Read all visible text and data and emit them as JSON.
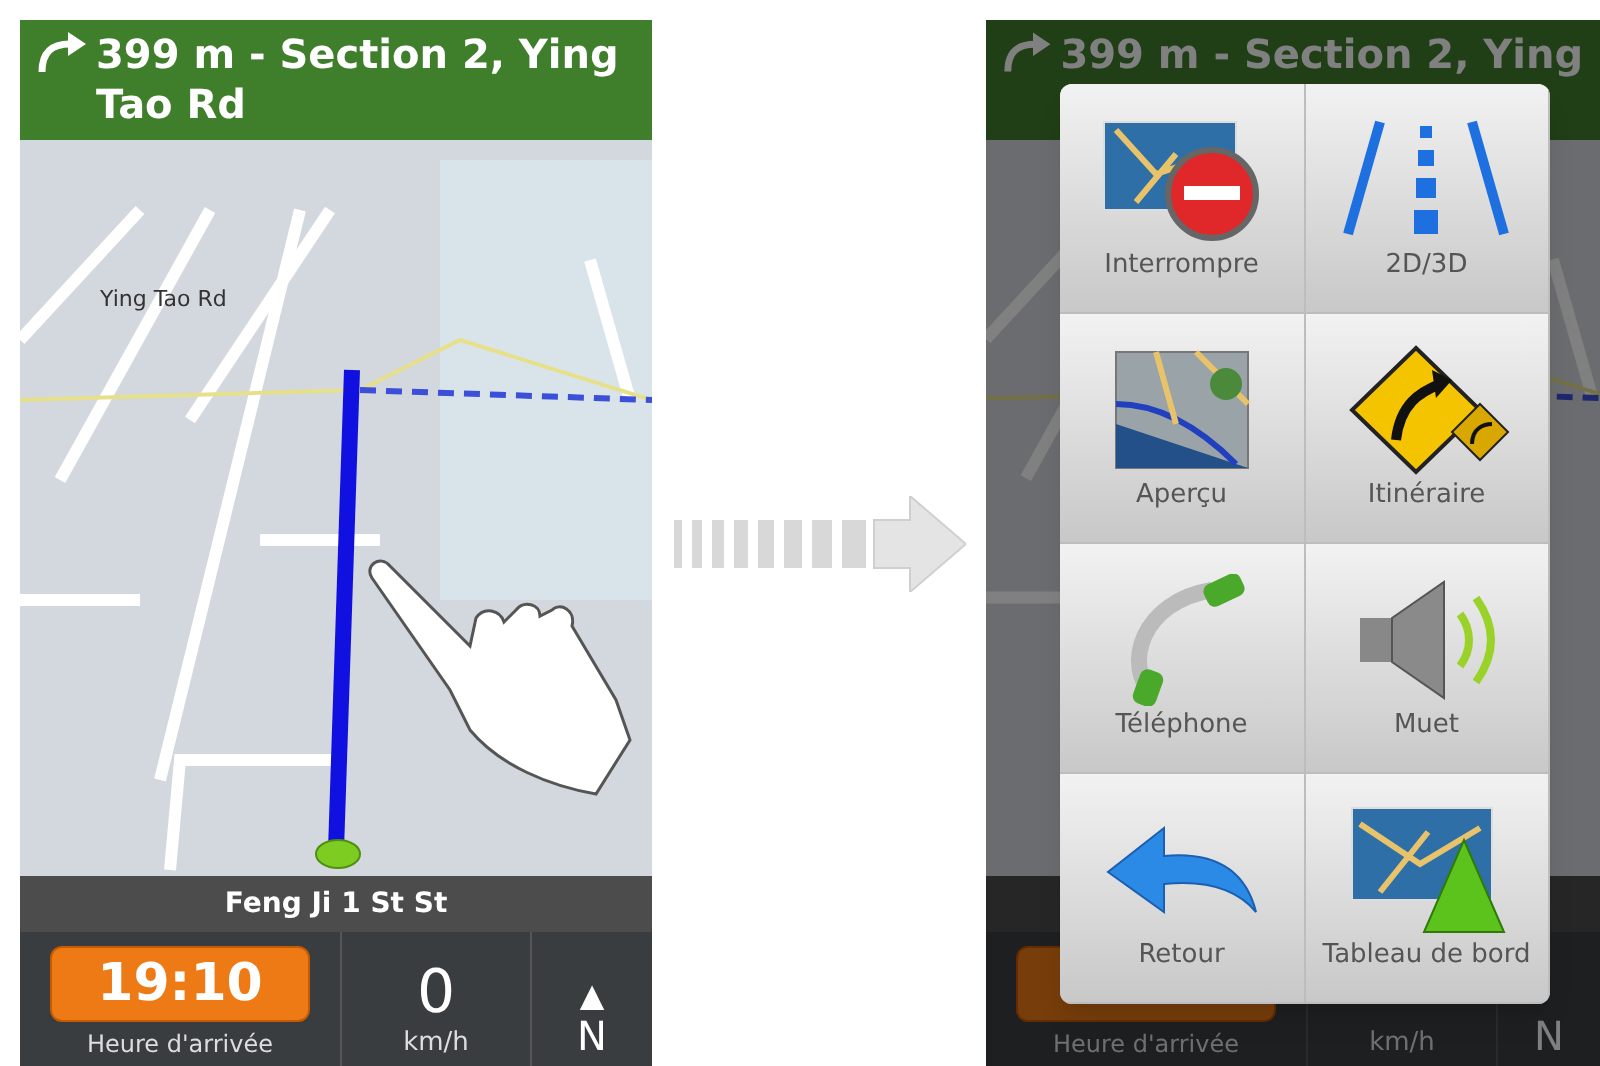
{
  "left_screen": {
    "instruction": "399 m - Section 2, Ying Tao Rd",
    "map_label": "Ying Tao Rd",
    "current_street": "Feng Ji 1 St St",
    "arrival_time": "19:10",
    "arrival_label": "Heure d'arrivée",
    "speed": "0",
    "speed_unit": "km/h",
    "compass_arrow": "▲",
    "compass_heading": "N"
  },
  "right_screen": {
    "instruction": "399 m - Section 2, Ying",
    "arrival_label": "Heure d'arrivée",
    "speed_unit": "km/h",
    "compass_heading": "N",
    "menu": [
      {
        "kind": "stop",
        "label": "Interrompre"
      },
      {
        "kind": "view",
        "label": "2D/3D"
      },
      {
        "kind": "overview",
        "label": "Aperçu"
      },
      {
        "kind": "route",
        "label": "Itinéraire"
      },
      {
        "kind": "phone",
        "label": "Téléphone"
      },
      {
        "kind": "mute",
        "label": "Muet"
      },
      {
        "kind": "back",
        "label": "Retour"
      },
      {
        "kind": "dashboard",
        "label": "Tableau de bord"
      }
    ]
  }
}
